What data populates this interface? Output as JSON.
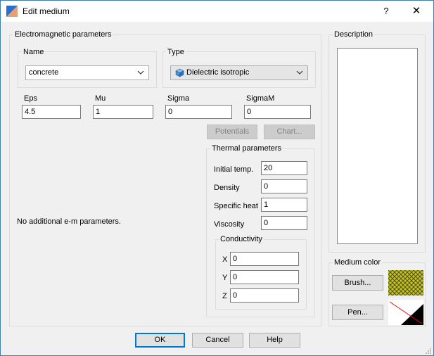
{
  "window": {
    "title": "Edit medium",
    "help_glyph": "?",
    "close_glyph": "✕"
  },
  "em": {
    "group_label": "Electromagnetic parameters",
    "name": {
      "group_label": "Name",
      "value": "concrete"
    },
    "type": {
      "group_label": "Type",
      "value": "Dielectric isotropic",
      "icon": "cube-icon"
    },
    "fields": {
      "eps": {
        "label": "Eps",
        "value": "4.5"
      },
      "mu": {
        "label": "Mu",
        "value": "1"
      },
      "sigma": {
        "label": "Sigma",
        "value": "0"
      },
      "sigmam": {
        "label": "SigmaM",
        "value": "0"
      }
    },
    "potentials_label": "Potentials",
    "chart_label": "Chart...",
    "no_params_text": "No additional e-m parameters."
  },
  "thermal": {
    "group_label": "Thermal parameters",
    "initial_temp": {
      "label": "Initial temp.",
      "value": "20"
    },
    "density": {
      "label": "Density",
      "value": "0"
    },
    "specific_heat": {
      "label": "Specific heat",
      "value": "1"
    },
    "viscosity": {
      "label": "Viscosity",
      "value": "0"
    },
    "conductivity": {
      "group_label": "Conductivity",
      "x": {
        "label": "X",
        "value": "0"
      },
      "y": {
        "label": "Y",
        "value": "0"
      },
      "z": {
        "label": "Z",
        "value": "0"
      }
    }
  },
  "description": {
    "group_label": "Description",
    "value": ""
  },
  "medium_color": {
    "group_label": "Medium color",
    "brush_label": "Brush...",
    "pen_label": "Pen...",
    "brush_color": "#c8c800",
    "pen_color": "#ff0000"
  },
  "footer": {
    "ok_label": "OK",
    "cancel_label": "Cancel",
    "help_label": "Help"
  }
}
